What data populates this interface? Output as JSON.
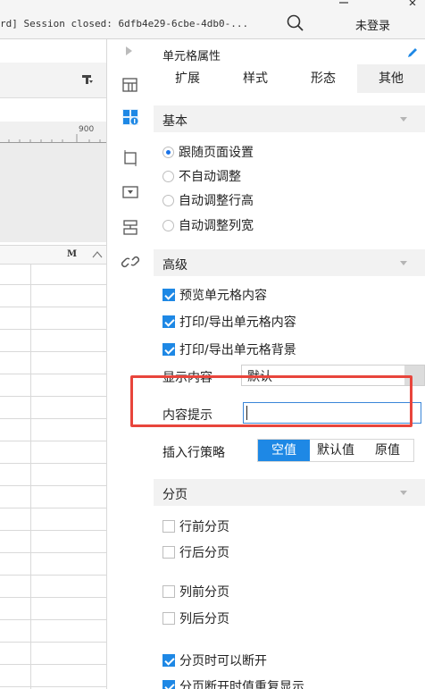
{
  "topbar": {
    "session_text": "rd] Session closed: 6dfb4e29-6cbe-4db0-...",
    "login_label": "未登录"
  },
  "left": {
    "ruler_number": "900",
    "column_label": "M"
  },
  "panel": {
    "title": "单元格属性",
    "tabs": [
      {
        "label": "扩展"
      },
      {
        "label": "样式"
      },
      {
        "label": "形态"
      },
      {
        "label": "其他"
      }
    ],
    "active_tab": "其他",
    "basic": {
      "header": "基本",
      "options": [
        {
          "label": "跟随页面设置",
          "selected": true
        },
        {
          "label": "不自动调整",
          "selected": false
        },
        {
          "label": "自动调整行高",
          "selected": false
        },
        {
          "label": "自动调整列宽",
          "selected": false
        }
      ]
    },
    "advanced": {
      "header": "高级",
      "checks": [
        {
          "label": "预览单元格内容",
          "checked": true
        },
        {
          "label": "打印/导出单元格内容",
          "checked": true
        },
        {
          "label": "打印/导出单元格背景",
          "checked": true
        }
      ],
      "display_content_label": "显示内容",
      "display_content_value": "默认",
      "tooltip_label": "内容提示",
      "tooltip_value": "",
      "insert_policy_label": "插入行策略",
      "insert_policy_options": [
        "空值",
        "默认值",
        "原值"
      ],
      "insert_policy_selected": "空值"
    },
    "paging": {
      "header": "分页",
      "checks": [
        {
          "label": "行前分页",
          "checked": false
        },
        {
          "label": "行后分页",
          "checked": false
        },
        {
          "label": "列前分页",
          "checked": false
        },
        {
          "label": "列后分页",
          "checked": false
        },
        {
          "label": "分页时可以断开",
          "checked": true
        },
        {
          "label": "分页断开时值重复显示",
          "checked": true
        }
      ]
    }
  },
  "colors": {
    "accent": "#1e88e5",
    "highlight_border": "#e8453c",
    "section_bg": "#f2f2f2"
  }
}
